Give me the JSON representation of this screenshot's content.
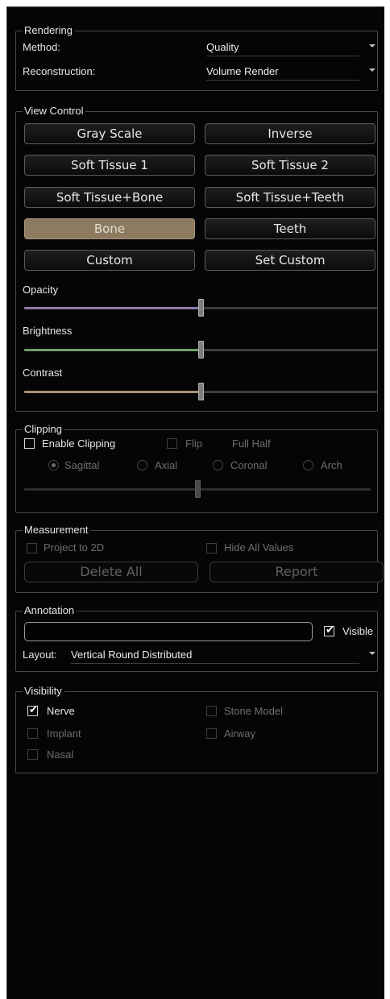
{
  "rendering": {
    "title": "Rendering",
    "method_label": "Method:",
    "method_value": "Quality",
    "reconstruction_label": "Reconstruction:",
    "reconstruction_value": "Volume Render"
  },
  "view_control": {
    "title": "View Control",
    "buttons": [
      "Gray Scale",
      "Inverse",
      "Soft Tissue 1",
      "Soft Tissue 2",
      "Soft Tissue+Bone",
      "Soft Tissue+Teeth",
      "Bone",
      "Teeth",
      "Custom",
      "Set Custom"
    ],
    "active_button": "Bone",
    "opacity_label": "Opacity",
    "opacity_value": 0.5,
    "brightness_label": "Brightness",
    "brightness_value": 0.5,
    "contrast_label": "Contrast",
    "contrast_value": 0.5,
    "colors": {
      "opacity": "#8c7aa8",
      "brightness": "#6ea068",
      "contrast": "#a49470",
      "active": "#8c7b60"
    }
  },
  "clipping": {
    "title": "Clipping",
    "enable_label": "Enable Clipping",
    "enable_checked": false,
    "flip_label": "Flip",
    "full_half_label": "Full Half",
    "radios": [
      "Sagittal",
      "Axial",
      "Coronal",
      "Arch"
    ],
    "selected_radio": "Sagittal",
    "slider_value": 0.5
  },
  "measurement": {
    "title": "Measurement",
    "project_label": "Project to 2D",
    "hide_values_label": "Hide All Values",
    "delete_all_label": "Delete All",
    "report_label": "Report"
  },
  "annotation": {
    "title": "Annotation",
    "text_value": "",
    "visible_label": "Visible",
    "visible_checked": true,
    "layout_label": "Layout:",
    "layout_value": "Vertical Round Distributed"
  },
  "visibility": {
    "title": "Visibility",
    "nerve_label": "Nerve",
    "nerve_checked": true,
    "stone_model_label": "Stone Model",
    "implant_label": "Implant",
    "airway_label": "Airway",
    "nasal_label": "Nasal"
  }
}
